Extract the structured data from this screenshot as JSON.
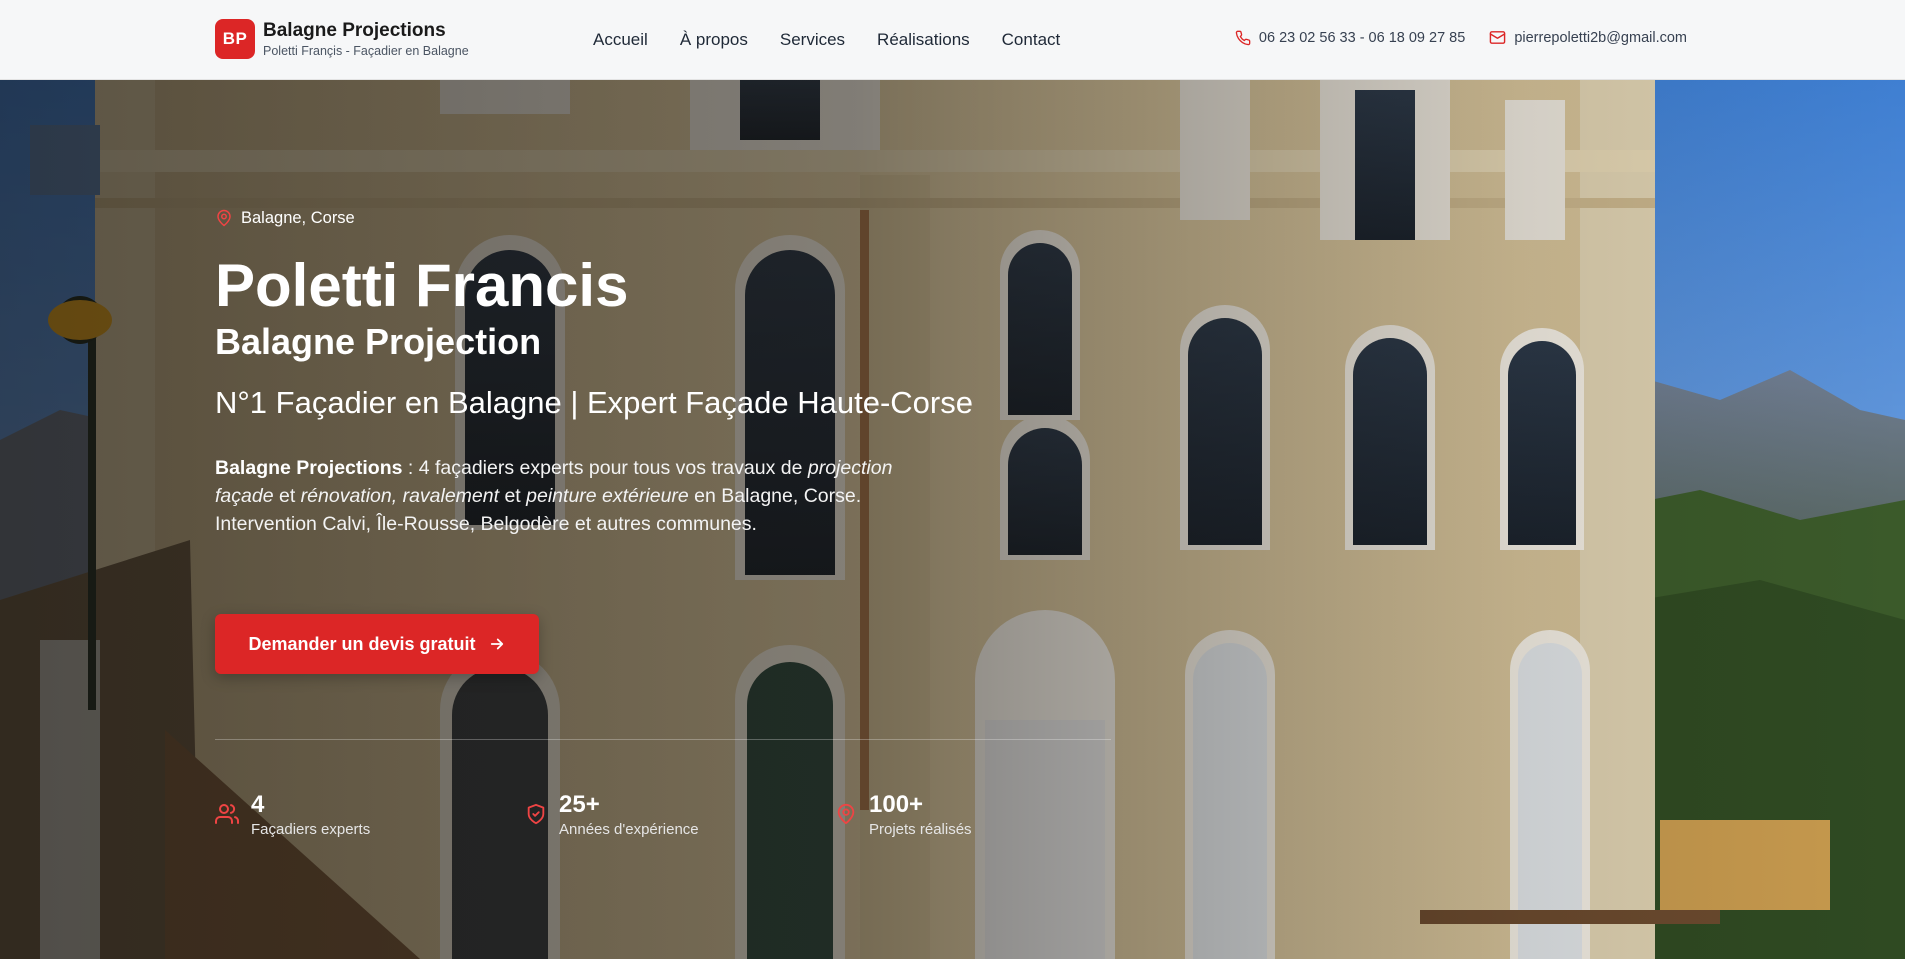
{
  "header": {
    "logo_initials": "BP",
    "brand_name": "Balagne Projections",
    "brand_subtitle": "Poletti Françis - Façadier en Balagne",
    "nav": [
      "Accueil",
      "À propos",
      "Services",
      "Réalisations",
      "Contact"
    ],
    "phone": "06 23 02 56 33 - 06 18 09 27 85",
    "email": "pierrepoletti2b@gmail.com",
    "phone_icon": "phone-icon",
    "email_icon": "mail-icon"
  },
  "hero": {
    "location": "Balagne, Corse",
    "title": "Poletti Francis",
    "subtitle": "Balagne Projection",
    "tagline": "N°1 Façadier en Balagne | Expert Façade Haute-Corse",
    "description": {
      "brand": "Balagne Projections",
      "part1": " : 4 façadiers experts pour tous vos travaux de ",
      "em1": "projection façade",
      "part2": " et ",
      "em2": "rénovation, ravalement",
      "part3": " et ",
      "em3": "peinture extérieure",
      "part4": " en Balagne, Corse. Intervention Calvi, Île-Rousse, Belgodère et autres communes."
    },
    "cta_label": "Demander un devis gratuit",
    "stats": [
      {
        "value": "4",
        "label": "Façadiers experts",
        "icon": "users-icon"
      },
      {
        "value": "25+",
        "label": "Années d'expérience",
        "icon": "shield-icon"
      },
      {
        "value": "100+",
        "label": "Projets réalisés",
        "icon": "map-pin-icon"
      }
    ]
  },
  "colors": {
    "accent": "#dc2626",
    "header_bg": "#f6f7f8",
    "facade": "#d9c8a0",
    "sky": "#5a8fd6"
  }
}
